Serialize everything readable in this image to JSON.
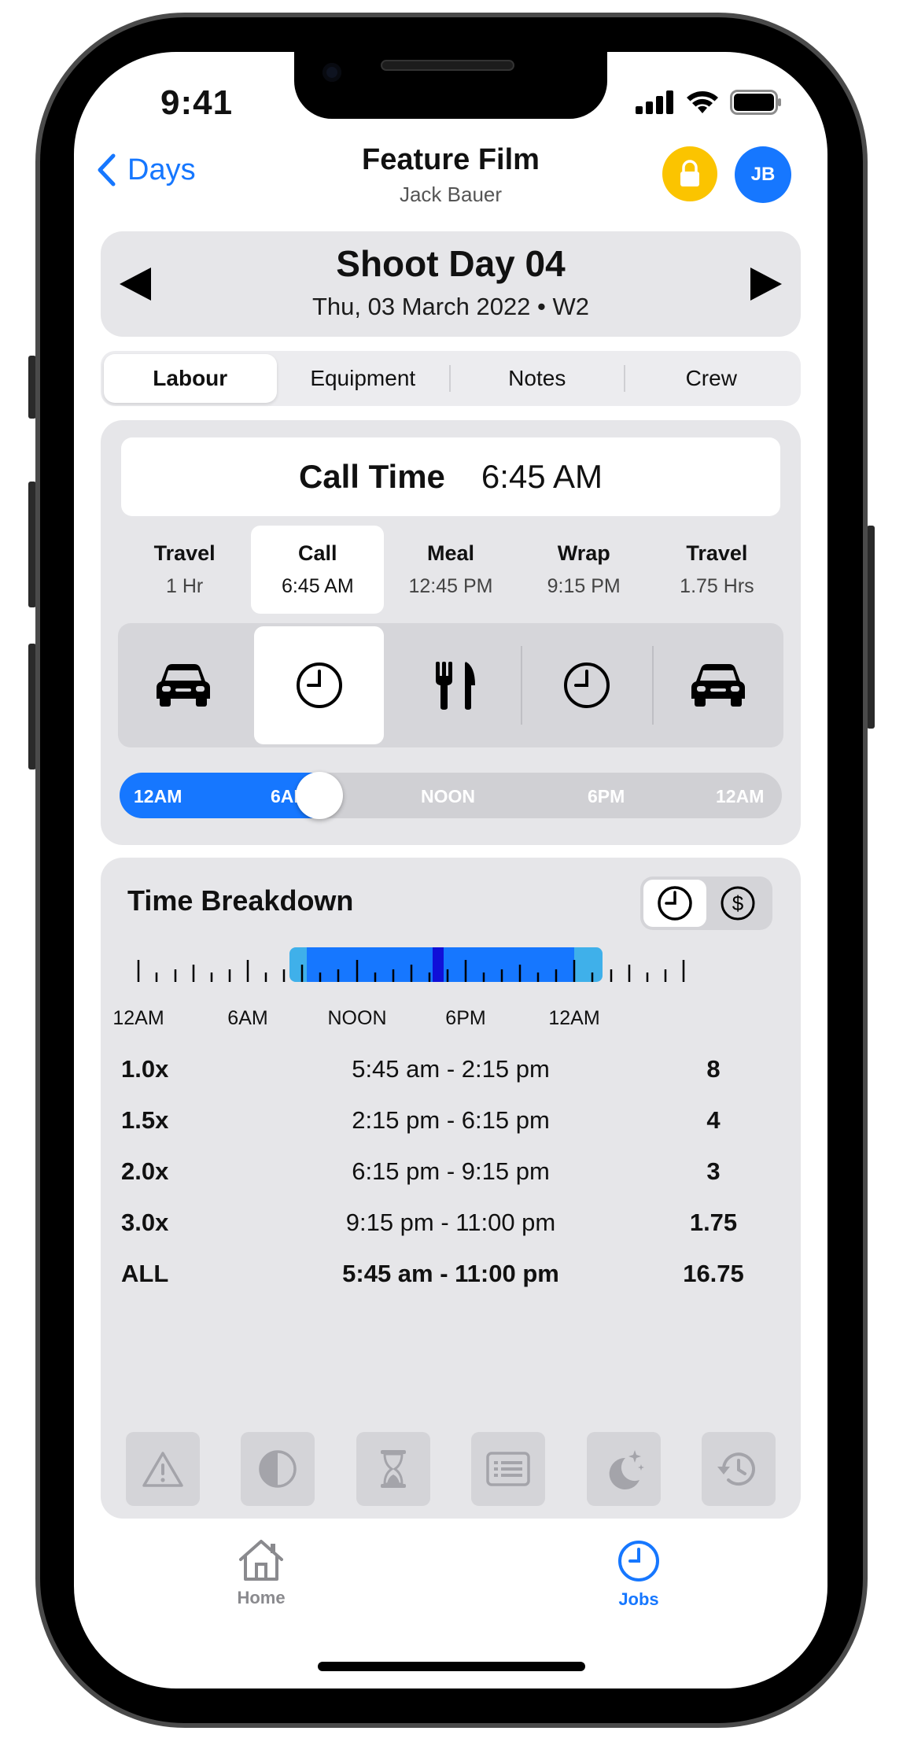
{
  "status_bar": {
    "time": "9:41"
  },
  "nav": {
    "back_label": "Days",
    "title": "Feature Film",
    "subtitle": "Jack Bauer",
    "avatar_initials": "JB",
    "lock_color": "#fbc400",
    "accent": "#1677ff"
  },
  "day": {
    "title": "Shoot Day 04",
    "subtitle": "Thu, 03 March 2022 • W2"
  },
  "tabs": [
    {
      "label": "Labour",
      "active": true
    },
    {
      "label": "Equipment",
      "active": false
    },
    {
      "label": "Notes",
      "active": false
    },
    {
      "label": "Crew",
      "active": false
    }
  ],
  "call_time": {
    "label": "Call Time",
    "value": "6:45 AM"
  },
  "phases": [
    {
      "title": "Travel",
      "time": "1 Hr",
      "icon": "car-icon",
      "active": false
    },
    {
      "title": "Call",
      "time": "6:45 AM",
      "icon": "clock-icon",
      "active": true
    },
    {
      "title": "Meal",
      "time": "12:45 PM",
      "icon": "cutlery-icon",
      "active": false
    },
    {
      "title": "Wrap",
      "time": "9:15 PM",
      "icon": "clock-icon",
      "active": false
    },
    {
      "title": "Travel",
      "time": "1.75 Hrs",
      "icon": "car-icon",
      "active": false
    }
  ],
  "time_slider": {
    "labels": [
      "12AM",
      "6AM",
      "NOON",
      "6PM",
      "12AM"
    ],
    "position_fraction": 0.28
  },
  "time_breakdown": {
    "title": "Time Breakdown",
    "axis_labels": [
      "12AM",
      "6AM",
      "NOON",
      "6PM",
      "12AM"
    ],
    "rows": [
      {
        "rate": "1.0x",
        "range": "5:45 am - 2:15 pm",
        "hours": "8"
      },
      {
        "rate": "1.5x",
        "range": "2:15 pm - 6:15 pm",
        "hours": "4"
      },
      {
        "rate": "2.0x",
        "range": "6:15 pm - 9:15 pm",
        "hours": "3"
      },
      {
        "rate": "3.0x",
        "range": "9:15 pm - 11:00 pm",
        "hours": "1.75"
      }
    ],
    "total": {
      "rate": "ALL",
      "range": "5:45 am - 11:00 pm",
      "hours": "16.75"
    },
    "toggle_icons": [
      "clock-icon",
      "dollar-icon"
    ],
    "bottom_icons": [
      "warning-icon",
      "contrast-icon",
      "hourglass-icon",
      "list-icon",
      "moon-stars-icon",
      "history-icon"
    ]
  },
  "tab_bar": [
    {
      "label": "Home",
      "icon": "home-icon",
      "active": false
    },
    {
      "label": "Jobs",
      "icon": "clock-icon",
      "active": true
    }
  ]
}
